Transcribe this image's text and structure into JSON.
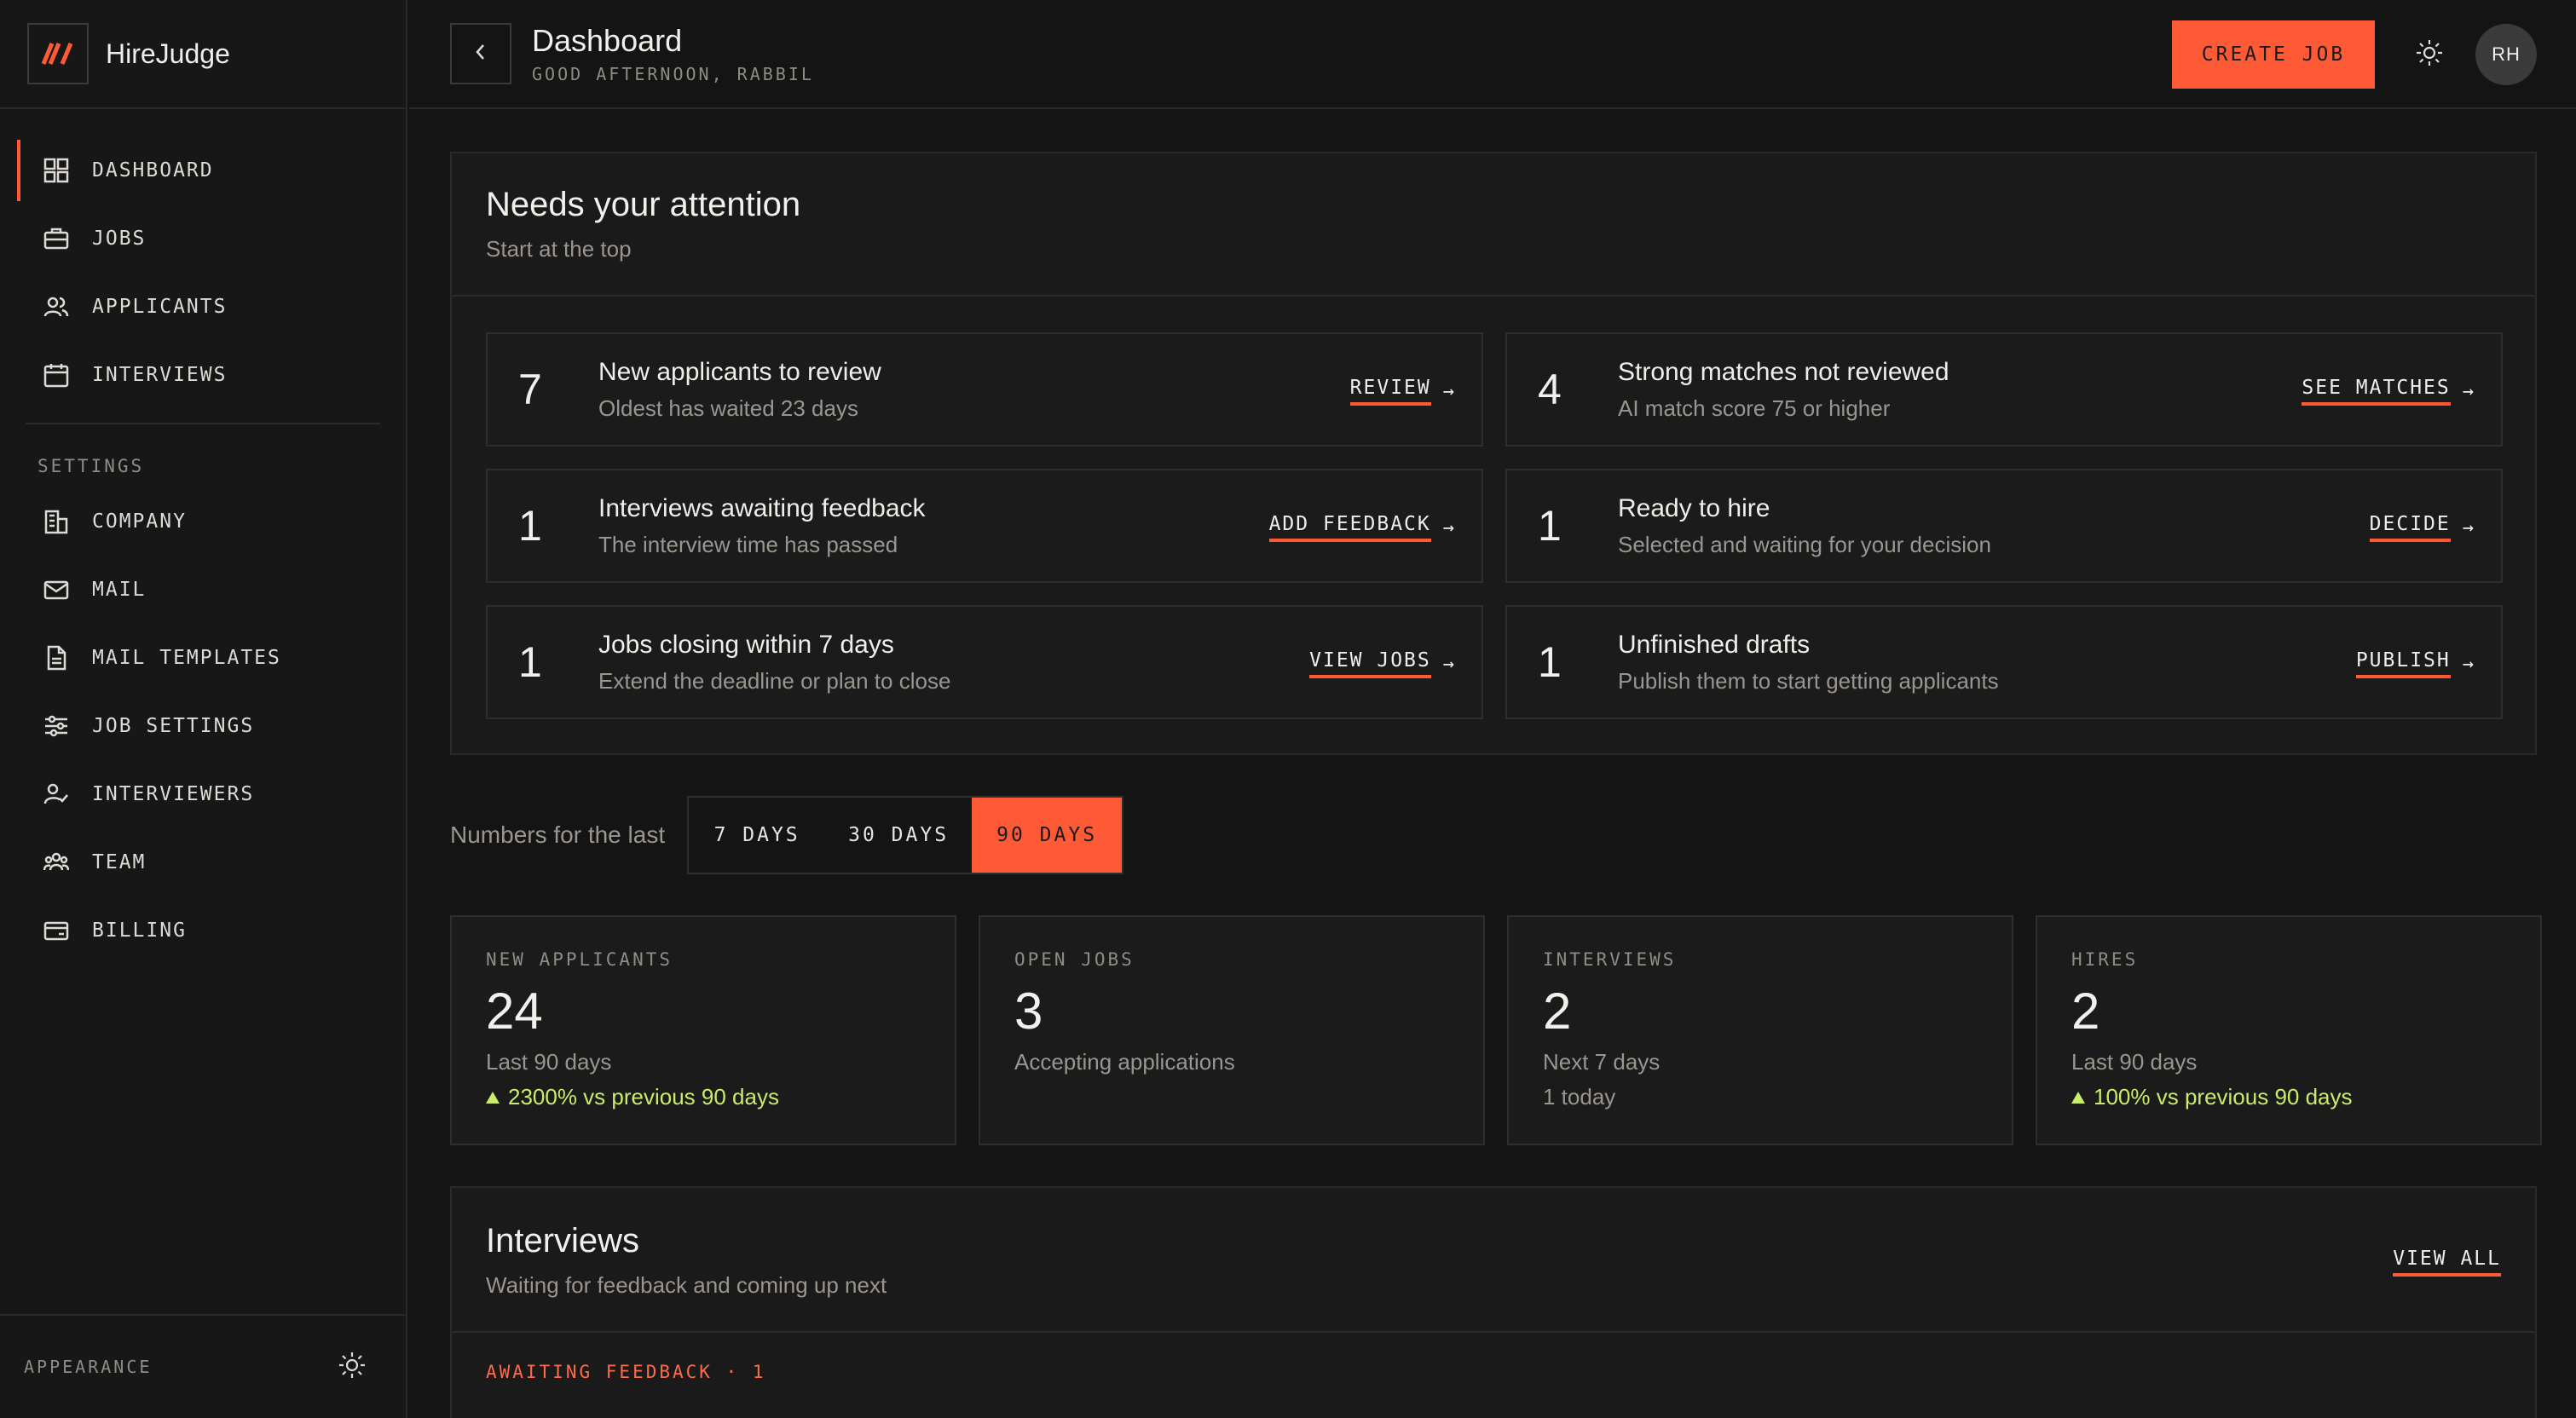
{
  "app": {
    "name": "HireJudge"
  },
  "sidebar": {
    "nav": [
      {
        "label": "DASHBOARD",
        "icon": "dashboard-grid-icon",
        "active": true
      },
      {
        "label": "JOBS",
        "icon": "briefcase-icon"
      },
      {
        "label": "APPLICANTS",
        "icon": "users-icon"
      },
      {
        "label": "INTERVIEWS",
        "icon": "calendar-icon"
      }
    ],
    "settings_heading": "SETTINGS",
    "settings": [
      {
        "label": "COMPANY",
        "icon": "building-icon"
      },
      {
        "label": "MAIL",
        "icon": "mail-icon"
      },
      {
        "label": "MAIL TEMPLATES",
        "icon": "document-icon"
      },
      {
        "label": "JOB SETTINGS",
        "icon": "sliders-icon"
      },
      {
        "label": "INTERVIEWERS",
        "icon": "user-check-icon"
      },
      {
        "label": "TEAM",
        "icon": "team-icon"
      },
      {
        "label": "BILLING",
        "icon": "credit-card-icon"
      }
    ],
    "footer_label": "APPEARANCE"
  },
  "header": {
    "title": "Dashboard",
    "greeting": "GOOD AFTERNOON, RABBIL",
    "create_label": "CREATE JOB",
    "avatar_initials": "RH"
  },
  "attention": {
    "title": "Needs your attention",
    "subtitle": "Start at the top",
    "items": [
      {
        "count": "7",
        "title": "New applicants to review",
        "subtitle": "Oldest has waited 23 days",
        "action": "REVIEW"
      },
      {
        "count": "4",
        "title": "Strong matches not reviewed",
        "subtitle": "AI match score 75 or higher",
        "action": "SEE MATCHES"
      },
      {
        "count": "1",
        "title": "Interviews awaiting feedback",
        "subtitle": "The interview time has passed",
        "action": "ADD FEEDBACK"
      },
      {
        "count": "1",
        "title": "Ready to hire",
        "subtitle": "Selected and waiting for your decision",
        "action": "DECIDE"
      },
      {
        "count": "1",
        "title": "Jobs closing within 7 days",
        "subtitle": "Extend the deadline or plan to close",
        "action": "VIEW JOBS"
      },
      {
        "count": "1",
        "title": "Unfinished drafts",
        "subtitle": "Publish them to start getting applicants",
        "action": "PUBLISH"
      }
    ]
  },
  "range": {
    "label": "Numbers for the last",
    "options": [
      "7 DAYS",
      "30 DAYS",
      "90 DAYS"
    ],
    "selected": "90 DAYS"
  },
  "stats": [
    {
      "key": "NEW APPLICANTS",
      "value": "24",
      "detail": "Last 90 days",
      "trend": "2300% vs previous 90 days"
    },
    {
      "key": "OPEN JOBS",
      "value": "3",
      "detail": "Accepting applications",
      "extra": ""
    },
    {
      "key": "INTERVIEWS",
      "value": "2",
      "detail": "Next 7 days",
      "extra": "1 today"
    },
    {
      "key": "HIRES",
      "value": "2",
      "detail": "Last 90 days",
      "trend": "100% vs previous 90 days"
    }
  ],
  "interviews": {
    "title": "Interviews",
    "subtitle": "Waiting for feedback and coming up next",
    "view_all": "VIEW ALL",
    "section_label": "AWAITING FEEDBACK · 1"
  },
  "colors": {
    "accent": "#ff5a36",
    "positive": "#c9ec6a",
    "background": "#141414",
    "panel": "#1a1a1a"
  }
}
